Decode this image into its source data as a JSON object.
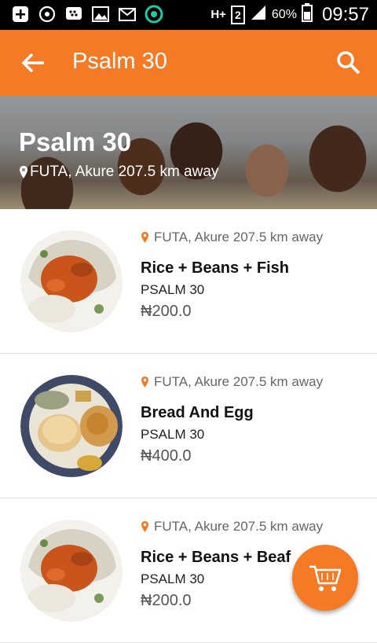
{
  "status_bar": {
    "battery": "60%",
    "time": "09:57",
    "sim": "2",
    "network": "H+"
  },
  "app_bar": {
    "title": "Psalm 30"
  },
  "hero": {
    "title": "Psalm 30",
    "location": "FUTA, Akure 207.5 km away"
  },
  "items": [
    {
      "location": "FUTA, Akure 207.5 km away",
      "name": "Rice + Beans + Fish",
      "vendor": "PSALM 30",
      "price": "₦200.0"
    },
    {
      "location": "FUTA, Akure 207.5 km away",
      "name": "Bread And Egg",
      "vendor": "PSALM 30",
      "price": "₦400.0"
    },
    {
      "location": "FUTA, Akure 207.5 km away",
      "name": "Rice + Beans + Beaf",
      "vendor": "PSALM 30",
      "price": "₦200.0"
    }
  ],
  "colors": {
    "primary": "#f47a25",
    "status_bar": "#000000",
    "text_dark": "#111111",
    "text_muted": "#666666"
  }
}
